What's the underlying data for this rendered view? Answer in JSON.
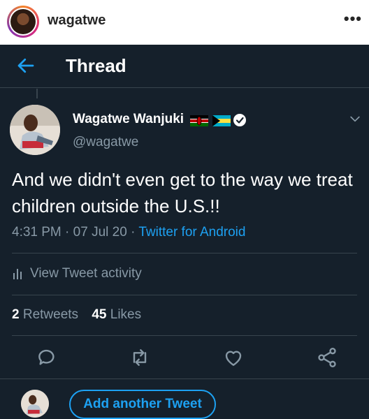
{
  "instagram": {
    "username": "wagatwe",
    "more_icon": "more-horizontal-icon"
  },
  "twitter": {
    "header_title": "Thread",
    "back_icon": "arrow-left-icon",
    "tweet": {
      "author_name": "Wagatwe Wanjuki",
      "handle": "@wagatwe",
      "flags": [
        "kenya-flag-icon",
        "bahamas-flag-icon"
      ],
      "verified_icon": "verified-badge-icon",
      "text": "And we didn't even get to the way we treat children outside the U.S.!!",
      "time": "4:31 PM",
      "date": "07 Jul 20",
      "source": "Twitter for Android",
      "separator": "·",
      "activity_label": "View Tweet activity",
      "retweets_count": "2",
      "retweets_label": "Retweets",
      "likes_count": "45",
      "likes_label": "Likes"
    },
    "actions": [
      "reply-icon",
      "retweet-icon",
      "like-icon",
      "share-icon"
    ],
    "add_tweet_label": "Add another Tweet",
    "colors": {
      "background": "#15202b",
      "accent": "#1da1f2",
      "muted": "#8899a6",
      "divider": "#38444d"
    }
  }
}
